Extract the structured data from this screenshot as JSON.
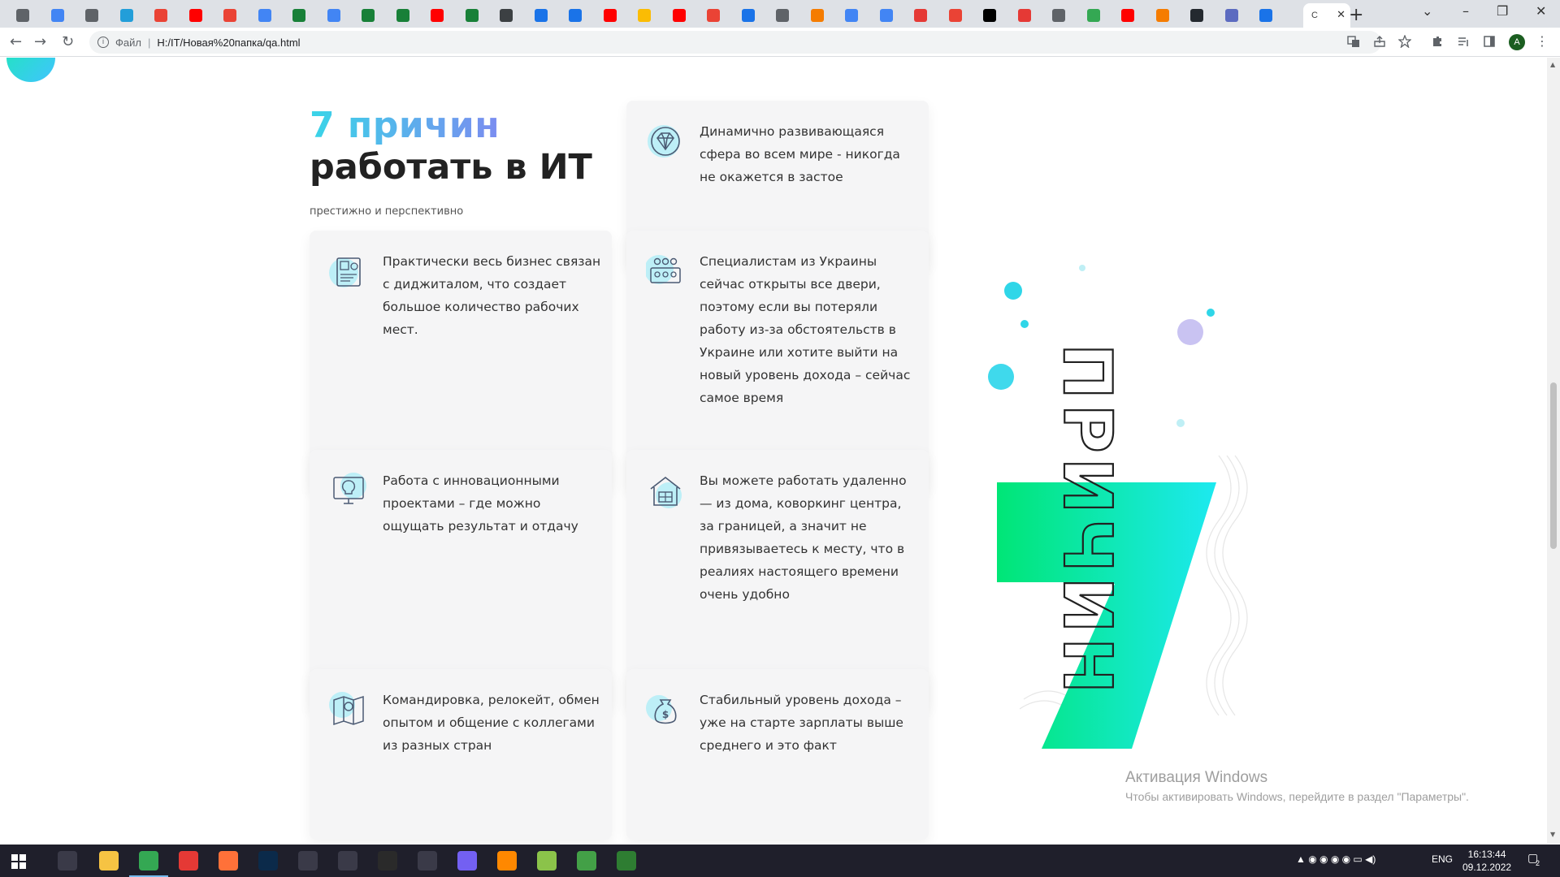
{
  "browser": {
    "active_tab_title": "С",
    "url_scheme_label": "Файл",
    "url": "H:/IT/Новая%20папка/qa.html",
    "profile_initial": "A",
    "tab_count_visible": 38
  },
  "page": {
    "title_accent": "7 причин",
    "title_main": "работать в ИТ",
    "subtitle": "престижно и перспективно",
    "cards": [
      {
        "icon": "diamond-icon",
        "text": "Динамично развивающаяся сфера во всем мире - никогда не окажется в застое"
      },
      {
        "icon": "business-docs-icon",
        "text": "Практически весь бизнес связан с диджиталом, что создает большое количество рабочих мест."
      },
      {
        "icon": "team-icon",
        "text": "Специалистам из Украины сейчас открыты все двери, поэтому если вы потеряли работу из-за обстоятельств в Украине или хотите выйти на новый уровень дохода – сейчас самое время"
      },
      {
        "icon": "lightbulb-icon",
        "text": "Работа с инновационными проектами – где можно ощущать результат и отдачу"
      },
      {
        "icon": "house-icon",
        "text": "Вы можете работать удаленно — из дома, коворкинг центра, за границей, а значит не привязываетесь к месту, что в реалиях настоящего времени очень удобно"
      },
      {
        "icon": "map-location-icon",
        "text": "Командировка, релокейт, обмен опытом и общение с коллегами из разных стран"
      },
      {
        "icon": "money-bag-icon",
        "text": "Стабильный уровень дохода – уже на старте зарплаты выше среднего и это факт"
      }
    ],
    "decor_number": "7",
    "decor_word": "ПРИЧИН"
  },
  "watermark": {
    "title": "Активация Windows",
    "body": "Чтобы активировать Windows, перейдите в раздел \"Параметры\"."
  },
  "taskbar": {
    "language": "ENG",
    "time": "16:13:44",
    "date": "09.12.2022",
    "notifications": "2"
  },
  "colors": {
    "accent_start": "#39d5e8",
    "accent_end": "#7b8cf0",
    "green": "#00e676",
    "cyan": "#1de9b6"
  }
}
